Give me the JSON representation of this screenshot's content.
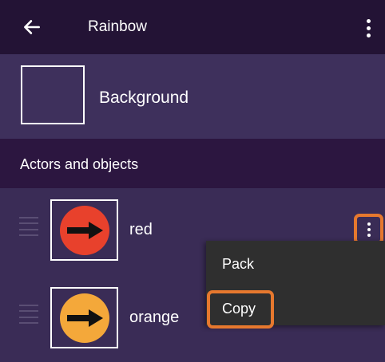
{
  "toolbar": {
    "title": "Rainbow",
    "back_icon": "arrow-left-icon",
    "overflow_icon": "more-vert-icon"
  },
  "background": {
    "label": "Background"
  },
  "section": {
    "label": "Actors and objects"
  },
  "items": [
    {
      "label": "red",
      "thumb_color": "#e8412c",
      "thumb_icon": "right-arrow-icon"
    },
    {
      "label": "orange",
      "thumb_color": "#f4a83a",
      "thumb_icon": "right-arrow-icon"
    }
  ],
  "popup_menu": {
    "items": [
      {
        "label": "Pack"
      },
      {
        "label": "Copy"
      }
    ]
  },
  "colors": {
    "toolbar_bg": "#231335",
    "content_bg": "#3a2c56",
    "section_bg": "#2c1640",
    "menu_bg": "#2f2f2f",
    "highlight": "#e6782e"
  }
}
